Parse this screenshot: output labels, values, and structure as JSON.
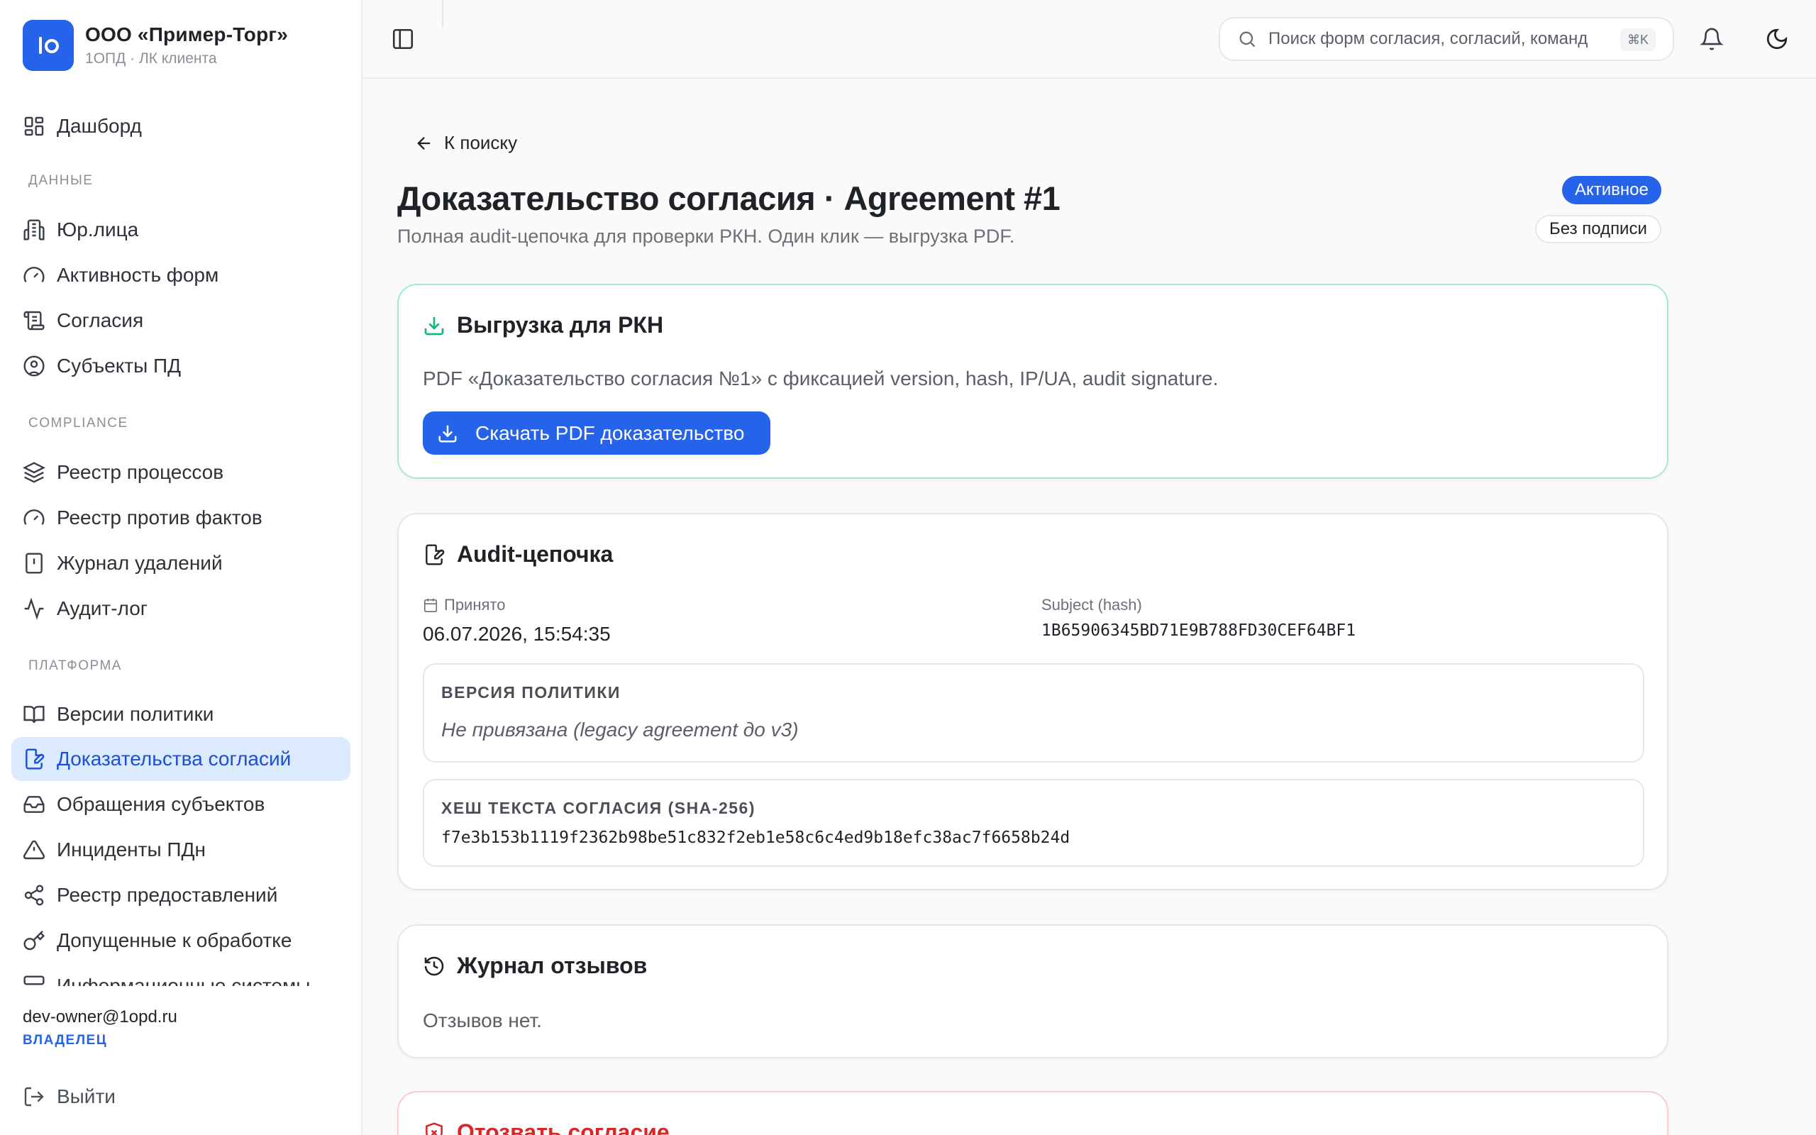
{
  "brand": {
    "name": "ООО «Пример-Торг»",
    "subtitle": "1ОПД · ЛК клиента",
    "color": "#2563eb"
  },
  "sidebar": {
    "dashboard": "Дашборд",
    "sections": {
      "data": "ДАННЫЕ",
      "compliance": "COMPLIANCE",
      "platform": "ПЛАТФОРМА"
    },
    "data_items": [
      "Юр.лица",
      "Активность форм",
      "Согласия",
      "Субъекты ПД"
    ],
    "compliance_items": [
      "Реестр процессов",
      "Реестр против фактов",
      "Журнал удалений",
      "Аудит-лог"
    ],
    "platform_items": [
      "Версии политики",
      "Доказательства согласий",
      "Обращения субъектов",
      "Инциденты ПДн",
      "Реестр предоставлений",
      "Допущенные к обработке",
      "Информационные системы"
    ],
    "active_item": "Доказательства согласий",
    "user_email": "dev-owner@1opd.ru",
    "user_role": "ВЛАДЕЛЕЦ",
    "logout": "Выйти"
  },
  "topbar": {
    "search_placeholder": "Поиск форм согласия, согласий, команд",
    "search_shortcut": "⌘K"
  },
  "page": {
    "back_label": "К поиску",
    "title": "Доказательство согласия · Agreement #1",
    "subtitle": "Полная audit-цепочка для проверки РКН. Один клик — выгрузка PDF.",
    "status_badge": "Активное",
    "sign_badge": "Без подписи"
  },
  "export_card": {
    "title": "Выгрузка для РКН",
    "description": "PDF «Доказательство согласия №1» с фиксацией version, hash, IP/UA, audit signature.",
    "button": "Скачать PDF доказательство"
  },
  "audit_card": {
    "title": "Audit-цепочка",
    "accepted_label": "Принято",
    "accepted_value": "06.07.2026, 15:54:35",
    "subject_label": "Subject (hash)",
    "subject_value": "1B65906345BD71E9B788FD30CEF64BF1",
    "policy_title": "ВЕРСИЯ ПОЛИТИКИ",
    "policy_value": "Не привязана (legacy agreement до v3)",
    "hash_title": "ХЕШ ТЕКСТА СОГЛАСИЯ (SHA-256)",
    "hash_value": "f7e3b153b1119f2362b98be51c832f2eb1e58c6c4ed9b18efc38ac7f6658b24d"
  },
  "revoke_card": {
    "title": "Журнал отзывов",
    "empty": "Отзывов нет."
  },
  "withdraw_card": {
    "title": "Отозвать согласие"
  }
}
